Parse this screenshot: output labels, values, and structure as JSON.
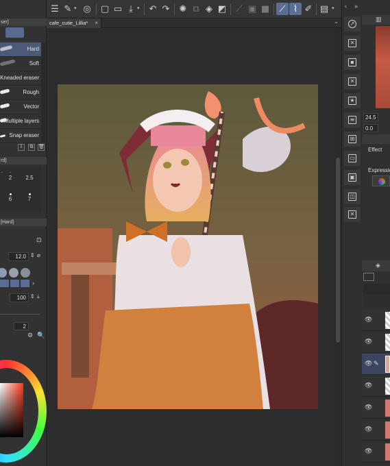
{
  "document": {
    "tab_label": "cafe_cutie_Lillia*",
    "close_glyph": "×"
  },
  "toolbar": {
    "icons": [
      "menu-icon",
      "eyedropper-icon",
      "layer-icon",
      "new-icon",
      "open-icon",
      "save-icon",
      "undo-icon",
      "redo-icon",
      "loading-icon",
      "transform-icon",
      "fill-icon",
      "clear-icon",
      "snap-icon",
      "ruler-icon",
      "grid-icon",
      "pen-icon",
      "settings-icon"
    ]
  },
  "left_panel": {
    "top_strip": "ser]",
    "erasers": [
      {
        "label": "Hard",
        "selected": true
      },
      {
        "label": "Soft",
        "selected": false
      },
      {
        "label": "Kneaded eraser",
        "selected": false
      },
      {
        "label": "Rough",
        "selected": false
      },
      {
        "label": "Vector",
        "selected": false
      },
      {
        "label": "Multiple layers",
        "selected": false
      },
      {
        "label": "Snap eraser",
        "selected": false
      }
    ],
    "size_strip": "rd]",
    "brush_sizes": [
      {
        "value": "."
      },
      {
        "value": "."
      },
      {
        "value": "2"
      },
      {
        "value": "2.5"
      },
      {
        "value": "."
      },
      {
        "value": "6"
      },
      {
        "value": "7"
      }
    ],
    "tool_property_strip": "[Hard]",
    "brush_size_value": "12.0",
    "opacity_value": "100",
    "hardness_value": "2"
  },
  "right_panel": {
    "navigator_value": "24.5",
    "navigator_value2": "0.0",
    "effect_label": "Effect",
    "expression_label": "Expressio"
  },
  "colors": {
    "accent": "#5b6f94",
    "panel": "#323232",
    "canvas_bg": "#2c2c2c"
  }
}
